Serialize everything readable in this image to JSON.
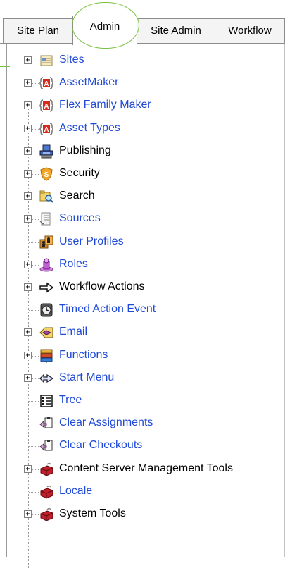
{
  "tabs": [
    {
      "label": "Site Plan"
    },
    {
      "label": "Admin"
    },
    {
      "label": "Site Admin"
    },
    {
      "label": "Workflow"
    }
  ],
  "tree": [
    {
      "label": "Sites",
      "icon": "sites-icon",
      "expandable": true,
      "link": true
    },
    {
      "label": "AssetMaker",
      "icon": "asset-maker-icon",
      "expandable": true,
      "link": true
    },
    {
      "label": "Flex Family Maker",
      "icon": "flex-family-maker-icon",
      "expandable": true,
      "link": true
    },
    {
      "label": "Asset Types",
      "icon": "asset-types-icon",
      "expandable": true,
      "link": true
    },
    {
      "label": "Publishing",
      "icon": "publishing-icon",
      "expandable": true,
      "link": false
    },
    {
      "label": "Security",
      "icon": "security-icon",
      "expandable": true,
      "link": false
    },
    {
      "label": "Search",
      "icon": "search-icon",
      "expandable": true,
      "link": false
    },
    {
      "label": "Sources",
      "icon": "sources-icon",
      "expandable": true,
      "link": true
    },
    {
      "label": "User Profiles",
      "icon": "user-profiles-icon",
      "expandable": false,
      "link": true
    },
    {
      "label": "Roles",
      "icon": "roles-icon",
      "expandable": true,
      "link": true
    },
    {
      "label": "Workflow Actions",
      "icon": "workflow-actions-icon",
      "expandable": true,
      "link": false
    },
    {
      "label": "Timed Action Event",
      "icon": "timed-action-icon",
      "expandable": false,
      "link": true
    },
    {
      "label": "Email",
      "icon": "email-icon",
      "expandable": true,
      "link": true
    },
    {
      "label": "Functions",
      "icon": "functions-icon",
      "expandable": true,
      "link": true
    },
    {
      "label": "Start Menu",
      "icon": "start-menu-icon",
      "expandable": true,
      "link": true
    },
    {
      "label": "Tree",
      "icon": "tree-icon",
      "expandable": false,
      "link": true
    },
    {
      "label": "Clear Assignments",
      "icon": "clear-assignments-icon",
      "expandable": false,
      "link": true
    },
    {
      "label": "Clear Checkouts",
      "icon": "clear-checkouts-icon",
      "expandable": false,
      "link": true
    },
    {
      "label": "Content Server Management Tools",
      "icon": "management-tools-icon",
      "expandable": true,
      "link": false
    },
    {
      "label": "Locale",
      "icon": "locale-icon",
      "expandable": false,
      "link": true
    },
    {
      "label": "System Tools",
      "icon": "system-tools-icon",
      "expandable": true,
      "link": false
    }
  ],
  "colors": {
    "link": "#1f49d6",
    "highlight": "#7ac143",
    "border": "#8c8c8c"
  }
}
